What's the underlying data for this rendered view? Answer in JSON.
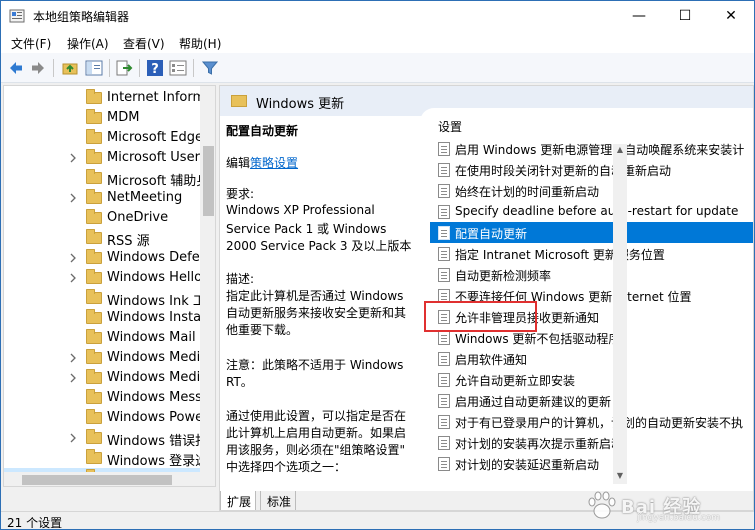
{
  "window": {
    "title": "本地组策略编辑器",
    "minimize": "—",
    "maximize": "☐",
    "close": "✕"
  },
  "menu": [
    "文件(F)",
    "操作(A)",
    "查看(V)",
    "帮助(H)"
  ],
  "toolbar": {
    "icons": [
      "back-arrow-icon",
      "forward-arrow-icon",
      "up-folder-icon",
      "show-hide-tree-icon",
      "export-list-icon",
      "help-icon",
      "properties-icon",
      "filter-icon"
    ]
  },
  "tree": {
    "items": [
      {
        "label": "Internet Informa",
        "expandable": false
      },
      {
        "label": "MDM",
        "expandable": false
      },
      {
        "label": "Microsoft Edge",
        "expandable": false
      },
      {
        "label": "Microsoft User",
        "expandable": true
      },
      {
        "label": "Microsoft 辅助身",
        "expandable": false
      },
      {
        "label": "NetMeeting",
        "expandable": true
      },
      {
        "label": "OneDrive",
        "expandable": false
      },
      {
        "label": "RSS 源",
        "expandable": false
      },
      {
        "label": "Windows Defen",
        "expandable": true
      },
      {
        "label": "Windows Hello",
        "expandable": true
      },
      {
        "label": "Windows Ink 工",
        "expandable": false
      },
      {
        "label": "Windows Install",
        "expandable": false
      },
      {
        "label": "Windows Mail",
        "expandable": false
      },
      {
        "label": "Windows Media",
        "expandable": true
      },
      {
        "label": "Windows Media",
        "expandable": true
      },
      {
        "label": "Windows Messe",
        "expandable": false
      },
      {
        "label": "Windows Power",
        "expandable": false
      },
      {
        "label": "Windows 错误报",
        "expandable": true
      },
      {
        "label": "Windows 登录选",
        "expandable": false
      },
      {
        "label": "Windows 更新",
        "expandable": false,
        "selected": true
      }
    ]
  },
  "right": {
    "header_title": "Windows 更新",
    "description": {
      "title": "配置自动更新",
      "edit_prefix": "编辑",
      "edit_link": "策略设置",
      "lines": [
        "要求:",
        "Windows XP Professional",
        "Service Pack 1 或 Windows",
        "2000 Service Pack 3 及以上版本",
        "描述:",
        "指定此计算机是否通过 Windows",
        "自动更新服务来接收安全更新和其",
        "他重要下载。",
        "注意：此策略不适用于 Windows",
        "RT。",
        "通过使用此设置，可以指定是否在",
        "此计算机上启用自动更新。如果启",
        "用该服务，则必须在\"组策略设置\"",
        "中选择四个选项之一："
      ]
    },
    "list": {
      "column_header": "设置",
      "items": [
        "启用 Windows 更新电源管理以自动唤醒系统来安装计",
        "在使用时段关闭针对更新的自动重新启动",
        "始终在计划的时间重新启动",
        "Specify deadline before auto-restart for update",
        "配置自动更新",
        "指定 Intranet Microsoft 更新服务位置",
        "自动更新检测频率",
        "不要连接任何 Windows 更新 Internet 位置",
        "允许非管理员接收更新通知",
        "Windows 更新不包括驱动程序",
        "启用软件通知",
        "允许自动更新立即安装",
        "启用通过自动更新建议的更新",
        "对于有已登录用户的计算机，计划的自动更新安装不执",
        "对计划的安装再次提示重新启动",
        "对计划的安装延迟重新启动"
      ],
      "selected_index": 4
    },
    "tabs": [
      "扩展",
      "标准"
    ]
  },
  "status": {
    "text": "21 个设置"
  },
  "watermark": {
    "text": "Bai 经验",
    "sub": "jingyan.baidu.com"
  },
  "colors": {
    "selection": "#0078d7",
    "highlight_box": "#e03030",
    "tree_selected": "#cce8ff",
    "link": "#0066cc"
  }
}
